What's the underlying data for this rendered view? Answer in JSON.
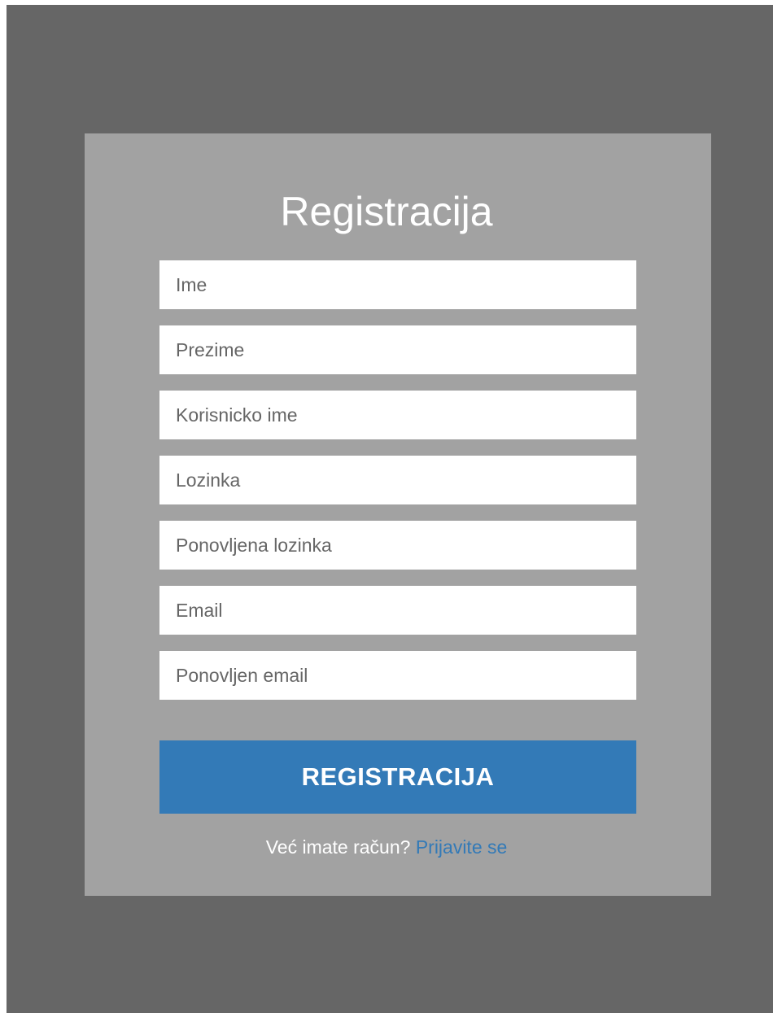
{
  "form": {
    "title": "Registracija",
    "fields": [
      {
        "name": "ime",
        "placeholder": "Ime",
        "value": ""
      },
      {
        "name": "prezime",
        "placeholder": "Prezime",
        "value": ""
      },
      {
        "name": "korisnicko-ime",
        "placeholder": "Korisnicko ime",
        "value": ""
      },
      {
        "name": "lozinka",
        "placeholder": "Lozinka",
        "value": ""
      },
      {
        "name": "ponovljena-lozinka",
        "placeholder": "Ponovljena lozinka",
        "value": ""
      },
      {
        "name": "email",
        "placeholder": "Email",
        "value": ""
      },
      {
        "name": "ponovljen-email",
        "placeholder": "Ponovljen email",
        "value": ""
      }
    ],
    "submit_label": "REGISTRACIJA",
    "footer_text": "Već imate račun?",
    "login_link": "Prijavite se"
  },
  "colors": {
    "page_background": "#666666",
    "card_background": "#a2a2a2",
    "accent": "#337ab7",
    "text_light": "#ffffff"
  }
}
